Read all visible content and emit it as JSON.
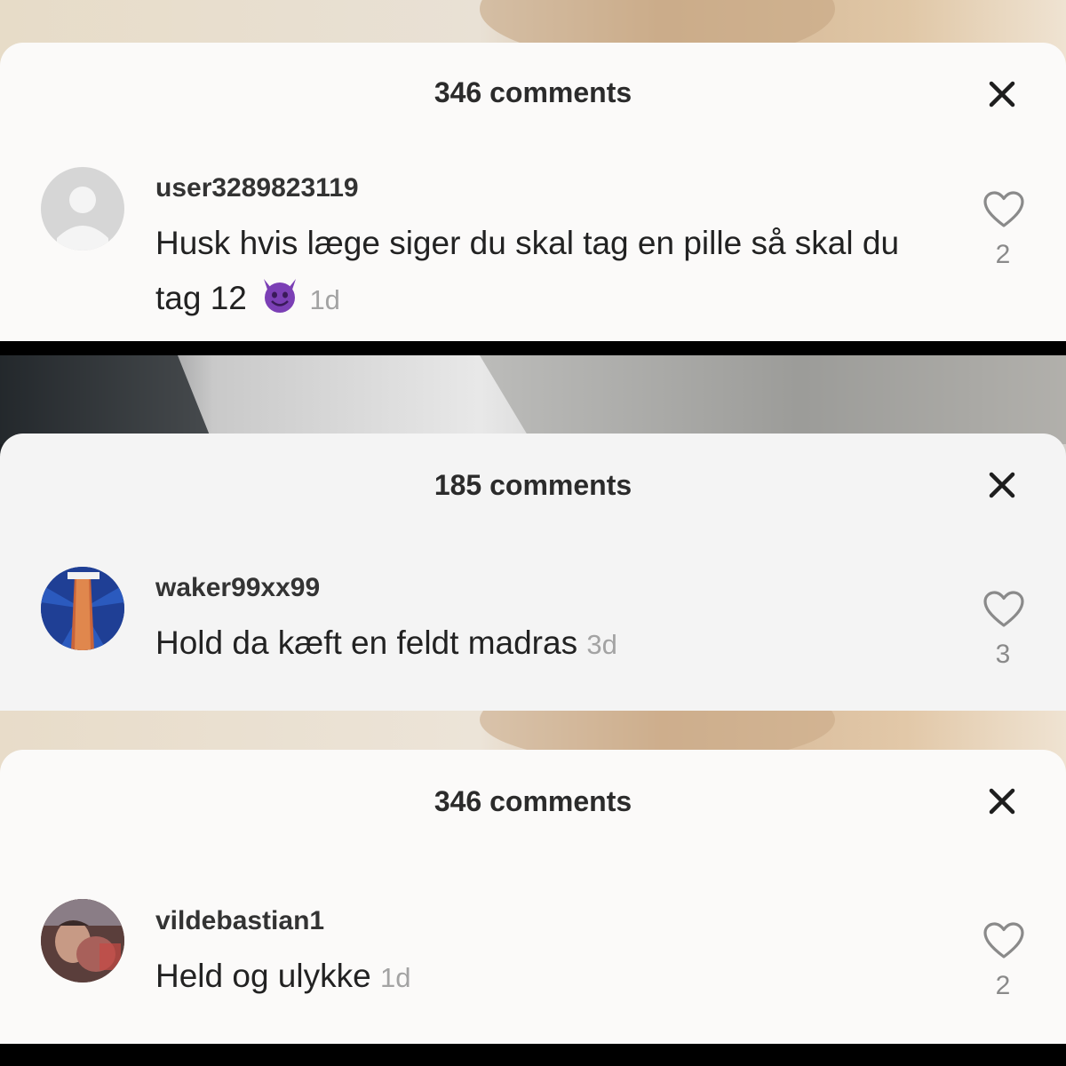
{
  "panels": [
    {
      "comment_count": "346 comments",
      "username": "user3289823119",
      "comment_text": "Husk hvis læge siger du skal tag en pille så skal du tag 12",
      "emoji": "smiling-devil-emoji",
      "time": "1d",
      "likes": "2"
    },
    {
      "comment_count": "185 comments",
      "username": "waker99xx99",
      "comment_text": "Hold da kæft en feldt madras",
      "time": "3d",
      "likes": "3"
    },
    {
      "comment_count": "346 comments",
      "username": "vildebastian1",
      "comment_text": "Held og ulykke",
      "time": "1d",
      "likes": "2"
    }
  ],
  "icons": {
    "close": "close-icon",
    "like": "heart-outline-icon",
    "default_avatar": "default-avatar-icon"
  },
  "colors": {
    "sheet": "#fbfaf9",
    "separator": "#000000",
    "timestamp": "#a3a3a3",
    "emoji_purple": "#7b3fb5"
  }
}
